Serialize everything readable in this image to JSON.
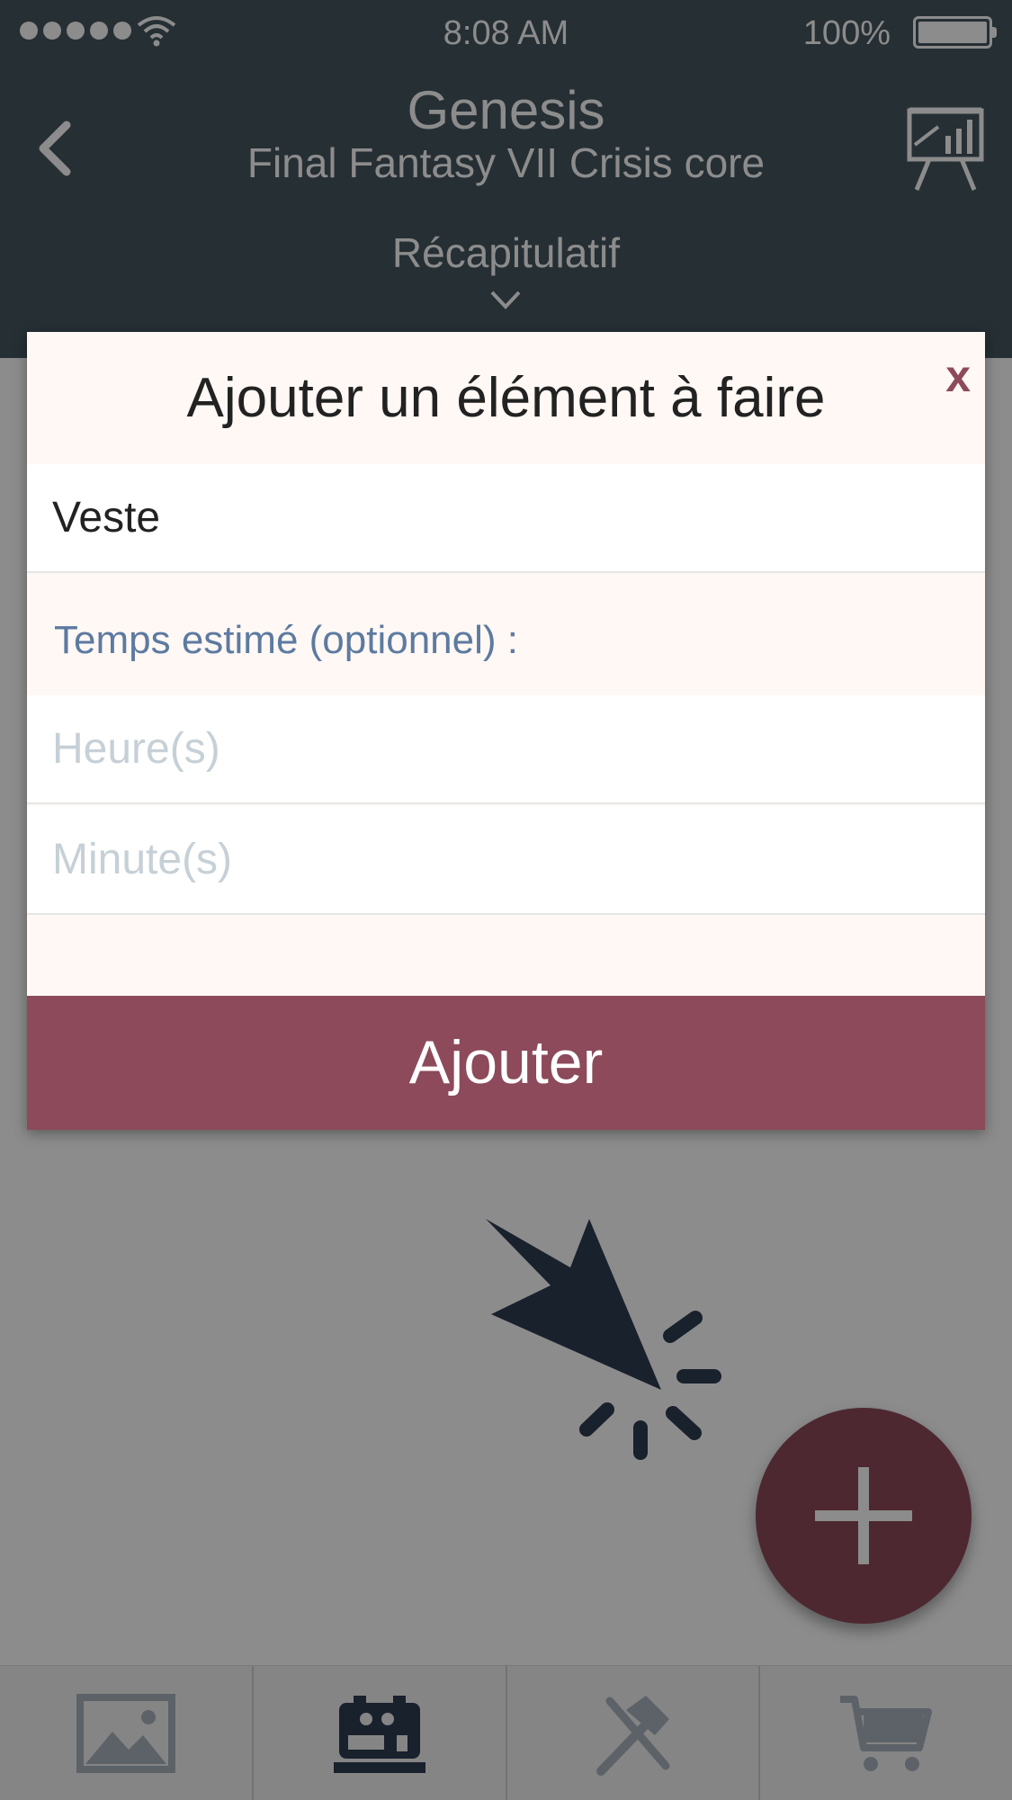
{
  "status_bar": {
    "time": "8:08 AM",
    "battery": "100%"
  },
  "header": {
    "title": "Genesis",
    "subtitle": "Final Fantasy VII Crisis core",
    "summary": "Récapitulatif",
    "back_icon": "chevron-left-icon",
    "stats_icon": "presentation-chart-icon"
  },
  "modal": {
    "title": "Ajouter un élément à faire",
    "close_label": "x",
    "name_value": "Veste",
    "time_label": "Temps estimé (optionnel) :",
    "hours_placeholder": "Heure(s)",
    "minutes_placeholder": "Minute(s)",
    "submit_label": "Ajouter"
  },
  "tabs": [
    {
      "icon": "image-icon"
    },
    {
      "icon": "sewing-machine-icon",
      "active": true
    },
    {
      "icon": "tools-icon"
    },
    {
      "icon": "cart-icon"
    }
  ],
  "colors": {
    "header_bg": "#46565f",
    "accent": "#8c4a5a",
    "icon_dark": "#2f3d52",
    "label_blue": "#5d7aa0",
    "modal_bg": "#fff8f5"
  }
}
